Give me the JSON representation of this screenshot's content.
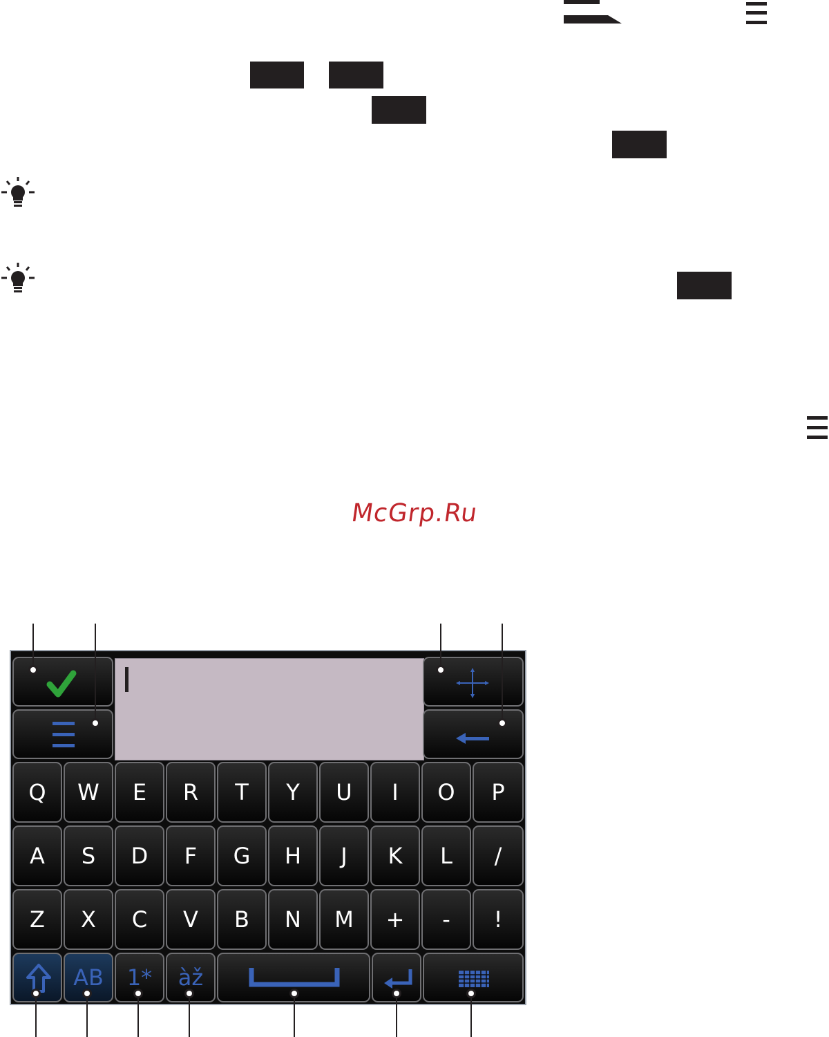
{
  "watermark": "McGrp.Ru",
  "keyboard": {
    "rows": [
      [
        "Q",
        "W",
        "E",
        "R",
        "T",
        "Y",
        "U",
        "I",
        "O",
        "P"
      ],
      [
        "A",
        "S",
        "D",
        "F",
        "G",
        "H",
        "J",
        "K",
        "L",
        "/"
      ],
      [
        "Z",
        "X",
        "C",
        "V",
        "B",
        "N",
        "M",
        "+",
        "-",
        "!"
      ]
    ],
    "function_keys": {
      "case": "AB",
      "numbers": "1*",
      "accents": "àž"
    }
  },
  "icons": {
    "confirm": "checkmark-icon",
    "menu": "menu-icon",
    "move": "move-arrows-icon",
    "backspace": "backspace-arrow-icon",
    "shift": "shift-arrow-icon",
    "space": "space-bar-icon",
    "enter": "enter-arrow-icon",
    "layout": "keyboard-grid-icon",
    "tip": "lightbulb-icon"
  },
  "colors": {
    "watermark": "#c0262c",
    "confirm_check": "#2fa33a",
    "key_accent": "#3a63b8",
    "text_field": "#c5b9c3"
  }
}
